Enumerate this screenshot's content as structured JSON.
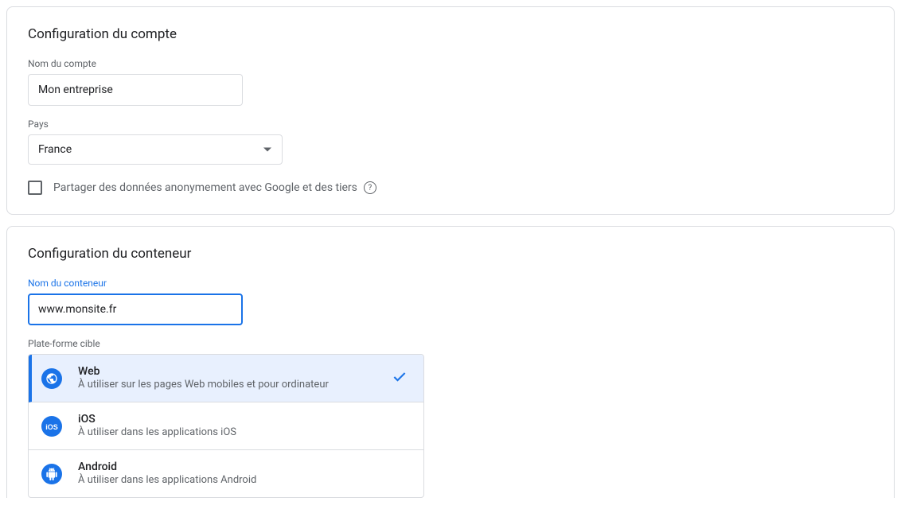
{
  "account": {
    "title": "Configuration du compte",
    "name_label": "Nom du compte",
    "name_value": "Mon entreprise",
    "country_label": "Pays",
    "country_value": "France",
    "share_label": "Partager des données anonymement avec Google et des tiers"
  },
  "container": {
    "title": "Configuration du conteneur",
    "name_label": "Nom du conteneur",
    "name_value": "www.monsite.fr",
    "platform_label": "Plate-forme cible",
    "platforms": [
      {
        "name": "Web",
        "desc": "À utiliser sur les pages Web mobiles et pour ordinateur",
        "selected": true
      },
      {
        "name": "iOS",
        "desc": "À utiliser dans les applications iOS",
        "selected": false
      },
      {
        "name": "Android",
        "desc": "À utiliser dans les applications Android",
        "selected": false
      }
    ]
  }
}
